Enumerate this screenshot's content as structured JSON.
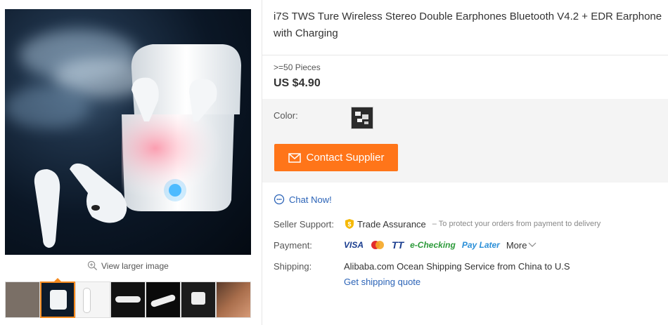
{
  "product": {
    "title": "i7S TWS Ture Wireless Stereo Double Earphones Bluetooth V4.2 + EDR Earphone with Charging",
    "quantity": ">=50 Pieces",
    "price": "US $4.90"
  },
  "gallery": {
    "view_larger": "View larger image",
    "accent": "#f58a1f"
  },
  "options": {
    "color_label": "Color:"
  },
  "actions": {
    "contact_supplier": "Contact Supplier",
    "chat_now": "Chat Now!",
    "button_color": "#ff7519",
    "link_color": "#2b63b7"
  },
  "seller_support": {
    "label": "Seller Support:",
    "name": "Trade Assurance",
    "note": "– To protect your orders from payment to delivery"
  },
  "payment": {
    "label": "Payment:",
    "methods": [
      "VISA",
      "TT",
      "e-Checking",
      "Pay Later"
    ],
    "more": "More"
  },
  "shipping": {
    "label": "Shipping:",
    "value": "Alibaba.com Ocean Shipping Service from China to U.S",
    "quote_link": "Get shipping quote"
  }
}
